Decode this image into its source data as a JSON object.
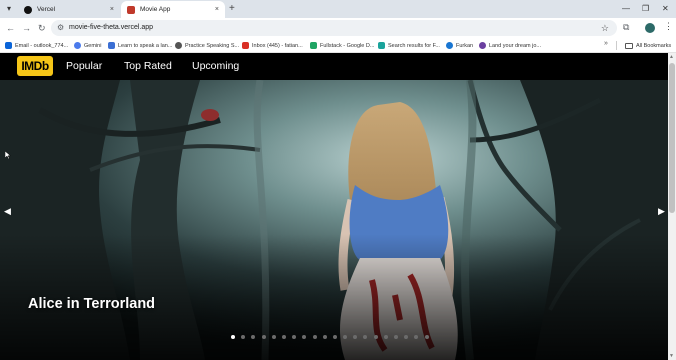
{
  "browser": {
    "tabs": [
      {
        "title": "Vercel",
        "active": false
      },
      {
        "title": "Movie App",
        "active": true
      }
    ],
    "tab_close_glyph": "×",
    "new_tab_glyph": "+",
    "url": "movie-five-theta.vercel.app",
    "bookmarks": [
      {
        "label": "Email - outlook_774...",
        "color": "#0a64d8"
      },
      {
        "label": "Gemini",
        "color": "#4b7bec"
      },
      {
        "label": "Learn to speak a lan...",
        "color": "#3b6fd4"
      },
      {
        "label": "Practice Speaking S...",
        "color": "#555555"
      },
      {
        "label": "Inbox (445) - fatian...",
        "color": "#d93025"
      },
      {
        "label": "Fullstack - Google D...",
        "color": "#1fa463"
      },
      {
        "label": "Search results for F...",
        "color": "#1aa39b"
      },
      {
        "label": "Furkan",
        "color": "#1976d2"
      },
      {
        "label": "Land your dream jo...",
        "color": "#6b3fa0"
      }
    ],
    "all_bookmarks_label": "All Bookmarks",
    "icons": {
      "tab_menu": "chevron-down-icon",
      "back": "arrow-left-icon",
      "forward": "arrow-right-icon",
      "reload": "reload-icon",
      "site_info": "tune-icon",
      "star": "star-icon",
      "extensions": "puzzle-icon",
      "menu": "kebab-icon"
    }
  },
  "app": {
    "logo": "IMDb",
    "nav": [
      {
        "label": "Popular"
      },
      {
        "label": "Top Rated"
      },
      {
        "label": "Upcoming"
      }
    ],
    "hero": {
      "title": "Alice in Terrorland",
      "slide_count": 20,
      "active_slide": 0
    },
    "colors": {
      "brand_yellow": "#f5c518",
      "background": "#000000",
      "text": "#ffffff",
      "dot_inactive": "#6b6b6b",
      "dot_active": "#ffffff"
    }
  }
}
